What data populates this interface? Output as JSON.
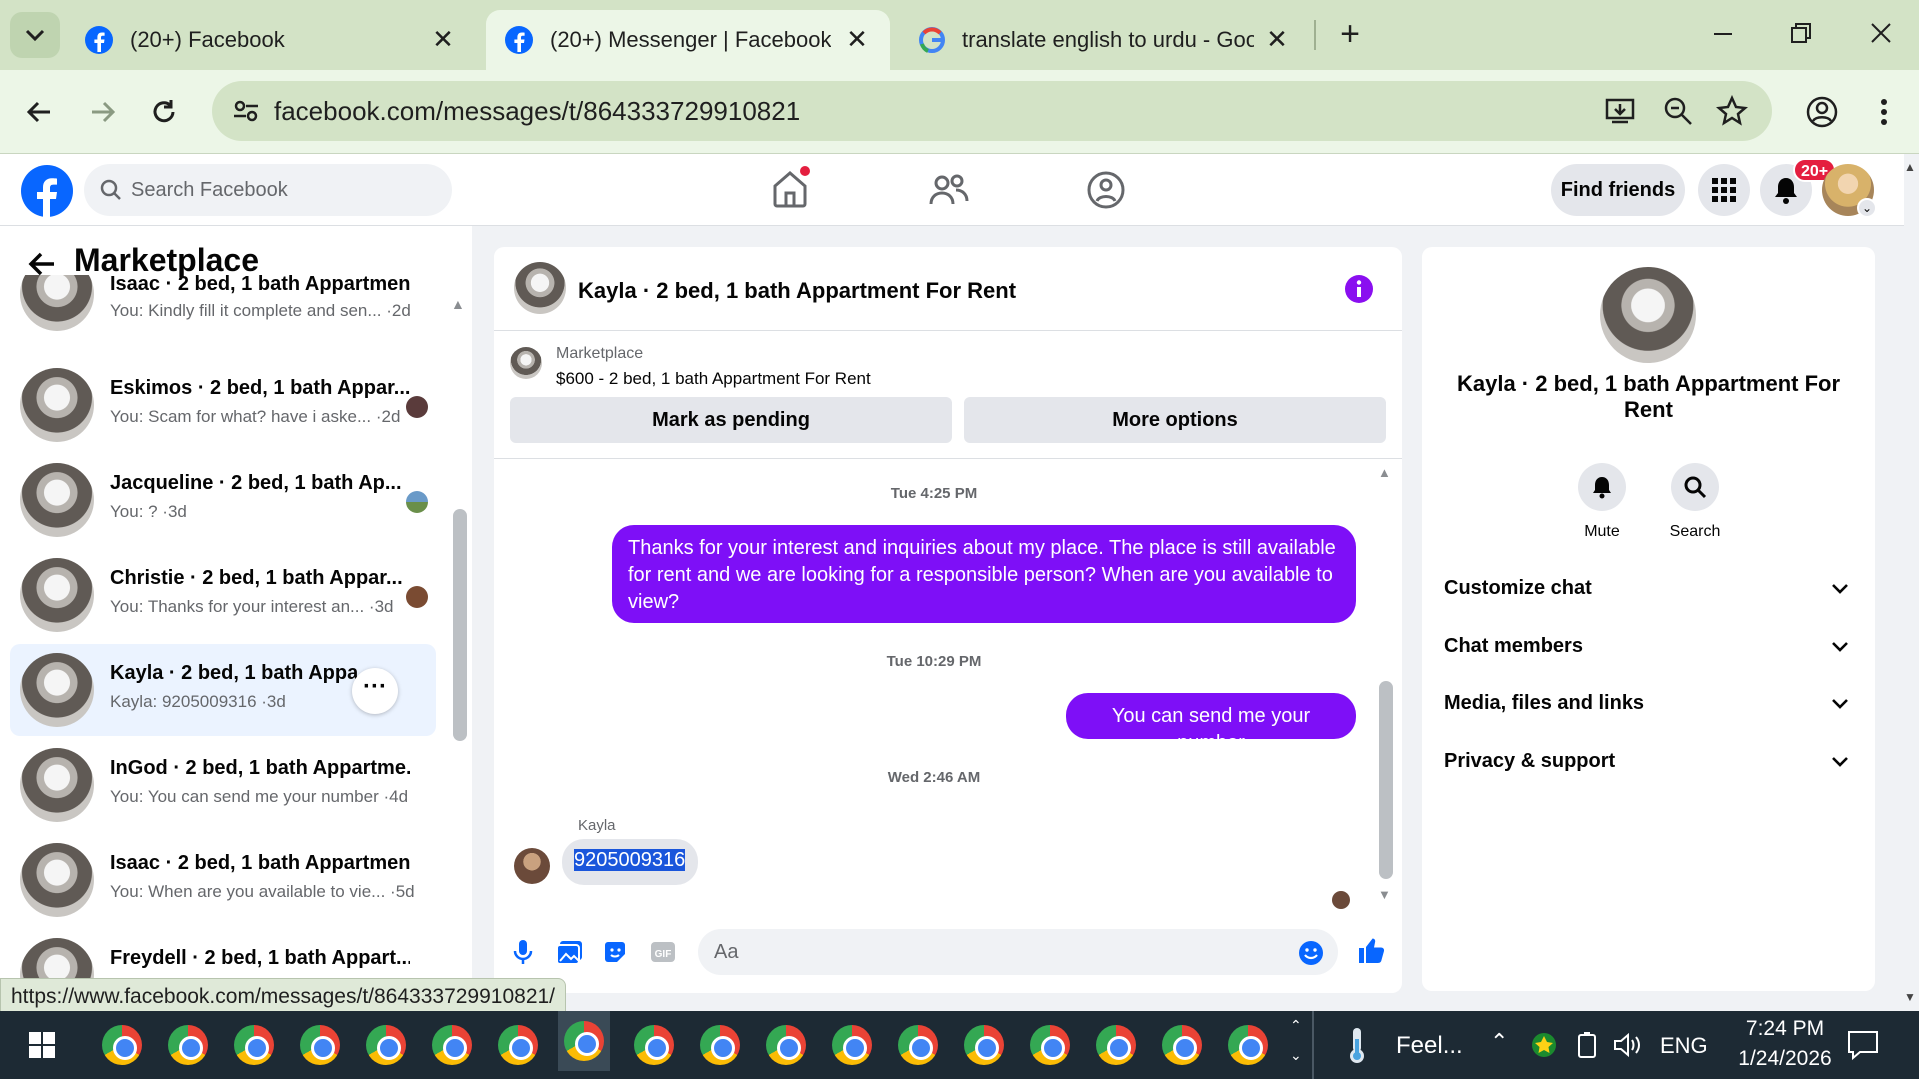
{
  "browser": {
    "tabs": [
      {
        "title": "(20+) Facebook",
        "active": false
      },
      {
        "title": "(20+) Messenger | Facebook",
        "active": true
      },
      {
        "title": "translate english to urdu - Goog",
        "active": false
      }
    ],
    "url": "facebook.com/messages/t/864333729910821",
    "status_url": "https://www.facebook.com/messages/t/864333729910821/"
  },
  "fb": {
    "search_placeholder": "Search Facebook",
    "find_friends": "Find friends",
    "notif_badge": "20+"
  },
  "sidebar": {
    "title": "Marketplace",
    "conversations": [
      {
        "name": "Isaac · 2 bed, 1 bath Appartmen...",
        "preview": "You: Kindly fill it complete and sen... ·2d"
      },
      {
        "name": "Eskimos · 2 bed, 1 bath Appar...",
        "preview": "You: Scam for what? have i aske... ·2d"
      },
      {
        "name": "Jacqueline · 2 bed, 1 bath Ap...",
        "preview": "You: ? ·3d"
      },
      {
        "name": "Christie · 2 bed, 1 bath Appar...",
        "preview": "You: Thanks for your interest an... ·3d"
      },
      {
        "name": "Kayla · 2 bed, 1 bath Appart",
        "preview": "Kayla: 9205009316 ·3d"
      },
      {
        "name": "InGod · 2 bed, 1 bath Appartme...",
        "preview": "You: You can send me your number ·4d"
      },
      {
        "name": "Isaac · 2 bed, 1 bath Appartmen...",
        "preview": "You: When are you available to vie... ·5d"
      },
      {
        "name": "Freydell · 2 bed, 1 bath Appart...",
        "preview": ""
      }
    ]
  },
  "chat": {
    "header_title": "Kayla · 2 bed, 1 bath Appartment For Rent",
    "listing_source": "Marketplace",
    "listing_title": "$600 - 2 bed, 1 bath Appartment For Rent",
    "mark_pending": "Mark as pending",
    "more_options": "More options",
    "stamp1": "Tue 4:25 PM",
    "msg1": "Thanks for your interest and inquiries about my place. The place is still available for rent and we are looking for a responsible person? When are you available to view?",
    "stamp2": "Tue 10:29 PM",
    "msg2": "You can send me your number",
    "stamp3": "Wed 2:46 AM",
    "incoming_sender": "Kayla",
    "incoming_msg": "9205009316",
    "composer_placeholder": "Aa"
  },
  "info": {
    "title": "Kayla · 2 bed, 1 bath Appartment For Rent",
    "mute": "Mute",
    "search": "Search",
    "sections": [
      "Customize chat",
      "Chat members",
      "Media, files and links",
      "Privacy & support"
    ]
  },
  "taskbar": {
    "weather": "Feel...",
    "lang": "ENG",
    "time": "7:24 PM",
    "date": "1/24/2026"
  },
  "colors": {
    "fb_blue": "#0866ff",
    "msg_purple": "#7e0ff7",
    "chrome_green": "#d3e3c6"
  }
}
